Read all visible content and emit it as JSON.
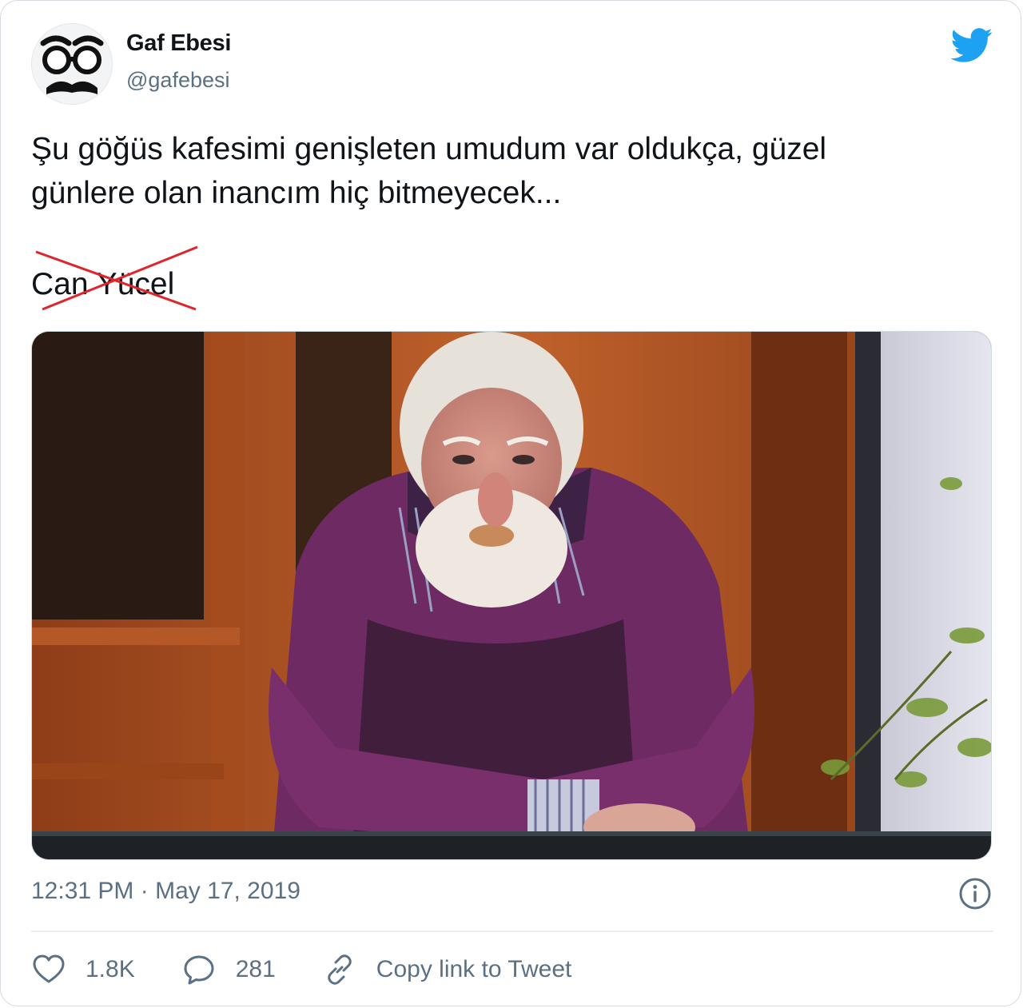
{
  "author": {
    "name": "Gaf Ebesi",
    "handle": "@gafebesi",
    "avatar_icon": "glasses-mustache-icon"
  },
  "brand": {
    "icon": "twitter-bird-icon",
    "color": "#1da1f2"
  },
  "tweet": {
    "text_line1": "Şu göğüs kafesimi genişleten umudum var oldukça, güzel",
    "text_line2": "günlere olan inancım hiç bitmeyecek...",
    "signature": "Can Yücel",
    "signature_strike_color": "#e0242b"
  },
  "media": {
    "colors": {
      "purple_sweater": "#6d2a63",
      "door_wood": "#b5582a",
      "wall": "#dcdde8",
      "beard": "#e8e2db"
    }
  },
  "meta": {
    "time": "12:31 PM",
    "separator": "·",
    "date": "May 17, 2019",
    "info_icon": "info-icon"
  },
  "actions": {
    "like_count": "1.8K",
    "reply_count": "281",
    "copy_link_label": "Copy link to Tweet"
  }
}
